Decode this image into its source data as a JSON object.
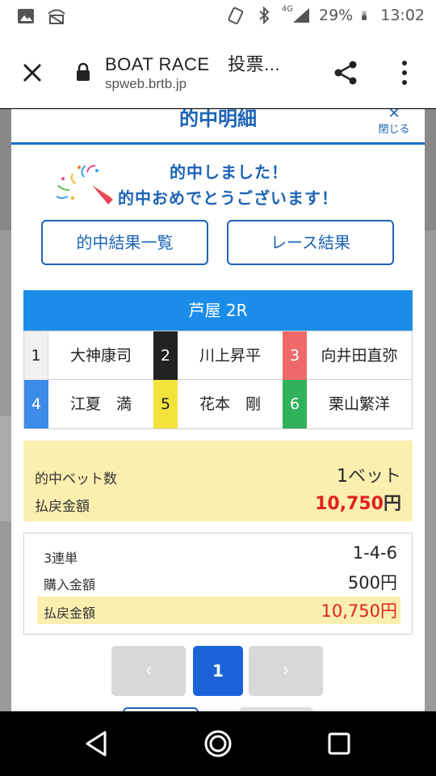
{
  "status_bar": {
    "battery": "29%",
    "time": "13:02",
    "network": "4G",
    "icons": [
      "image-icon",
      "wifi-off-icon",
      "nfc-icon",
      "bluetooth-icon",
      "signal-icon",
      "battery-charging-icon"
    ]
  },
  "browser": {
    "title": "BOAT RACE　投票...",
    "url": "spweb.brtb.jp",
    "icons": [
      "close-icon",
      "lock-icon",
      "share-icon",
      "more-vert-icon"
    ]
  },
  "modal": {
    "title": "的中明細",
    "close_label": "閉じる",
    "congrats_line1": "的中しました！",
    "congrats_line2": "的中おめでとうございます！",
    "btn_hit_list": "的中結果一覧",
    "btn_race_result": "レース結果",
    "race_title": "芦屋 2R",
    "racers": [
      {
        "num": "1",
        "name": "大神康司",
        "color": "#f1f1f1"
      },
      {
        "num": "2",
        "name": "川上昇平",
        "color": "#222222"
      },
      {
        "num": "3",
        "name": "向井田直弥",
        "color": "#ee6a6a"
      },
      {
        "num": "4",
        "name": "江夏　満",
        "color": "#3d8be8"
      },
      {
        "num": "5",
        "name": "花本　剛",
        "color": "#f3e33c"
      },
      {
        "num": "6",
        "name": "栗山繁洋",
        "color": "#2fb25b"
      }
    ],
    "summary": {
      "bet_count_label": "的中ベット数",
      "bet_count_value": "1",
      "bet_count_unit": "ベット",
      "payout_label": "払戻金額",
      "payout_value": "10,750",
      "payout_unit": "円"
    },
    "detail": {
      "type_label": "3連単",
      "combination": "1-4-6",
      "purchase_label": "購入金額",
      "purchase_value": "500円",
      "payout_label": "払戻金額",
      "payout_value": "10,750円"
    },
    "pager": {
      "prev": "‹",
      "current": "1",
      "next": "›"
    }
  }
}
